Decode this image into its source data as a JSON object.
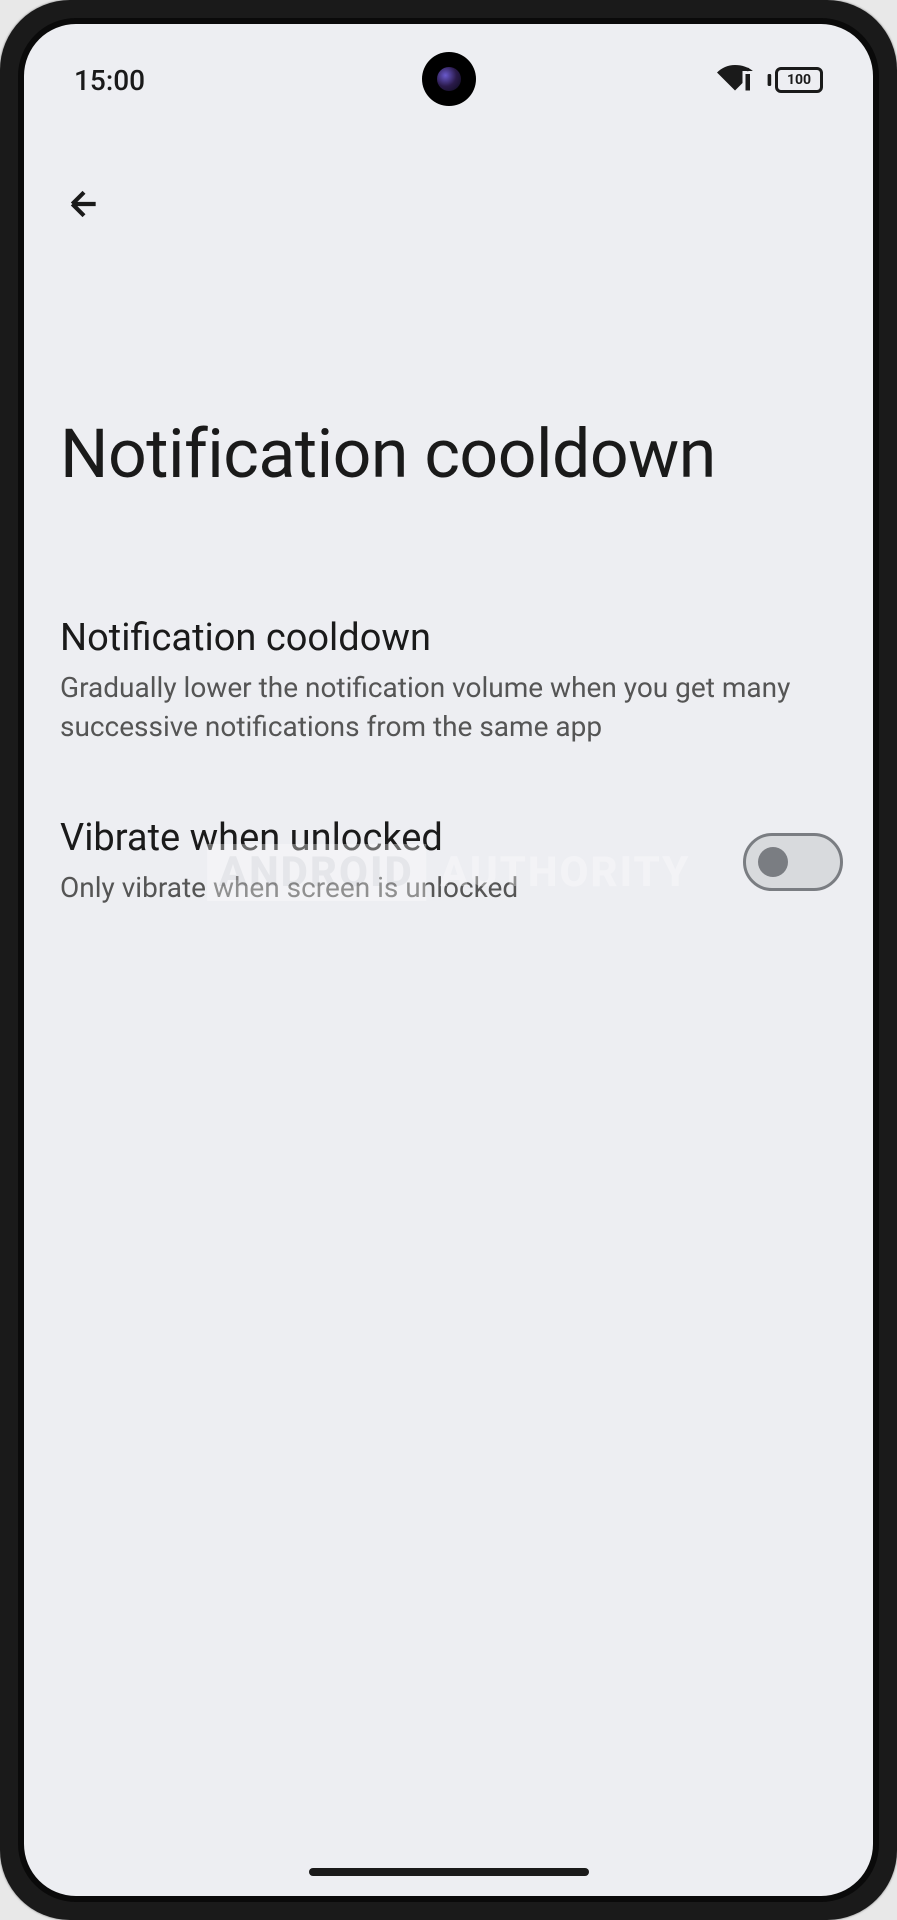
{
  "status_bar": {
    "time": "15:00",
    "battery_level": "100"
  },
  "page": {
    "title": "Notification cooldown"
  },
  "settings": [
    {
      "title": "Notification cooldown",
      "description": "Gradually lower the notification volume when you get many successive notifications from the same app",
      "has_toggle": false
    },
    {
      "title": "Vibrate when unlocked",
      "description": "Only vibrate when screen is unlocked",
      "has_toggle": true,
      "toggle_on": false
    }
  ],
  "watermark": {
    "part1": "ANDROID",
    "part2": "AUTHORITY"
  }
}
